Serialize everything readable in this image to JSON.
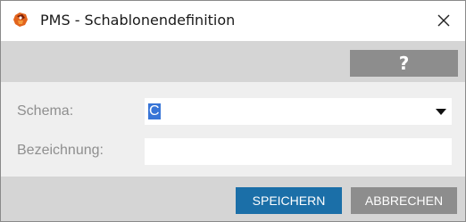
{
  "window": {
    "title": "PMS - Schablonendefinition",
    "app_icon": "pms-app-icon",
    "close_icon": "close-icon"
  },
  "toolbar": {
    "help_label": "?"
  },
  "form": {
    "schema_label": "Schema:",
    "schema_value": "C",
    "bezeichnung_label": "Bezeichnung:",
    "bezeichnung_value": ""
  },
  "footer": {
    "save_label": "SPEICHERN",
    "cancel_label": "ABBRECHEN"
  },
  "colors": {
    "primary": "#1b6fa8",
    "secondary": "#8d8d8d",
    "selection": "#3875d7",
    "toolbar_bg": "#d5d5d5",
    "form_bg": "#efefef"
  }
}
